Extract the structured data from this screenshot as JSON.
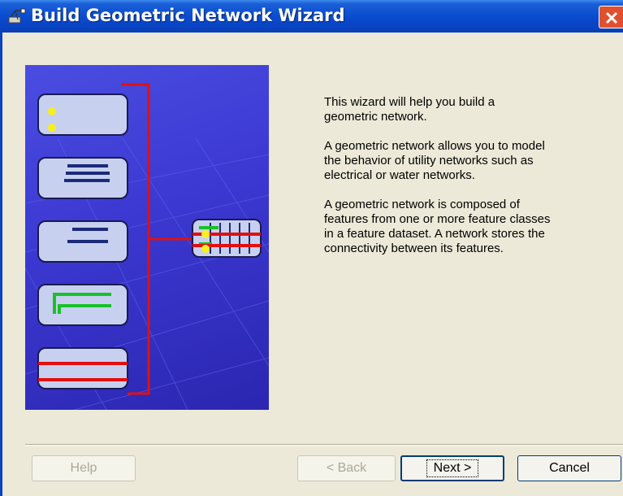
{
  "window": {
    "title": "Build Geometric Network Wizard"
  },
  "intro": {
    "paragraphs": [
      "This wizard will help you build a\ngeometric network.",
      "A geometric network allows you to model\nthe behavior of utility networks such as\nelectrical or water networks.",
      "A geometric network is composed of\nfeatures from one or more feature classes\nin a feature dataset. A network stores the\nconnectivity between its features."
    ]
  },
  "buttons": {
    "help": "Help",
    "back": "< Back",
    "next": "Next >",
    "cancel": "Cancel"
  }
}
